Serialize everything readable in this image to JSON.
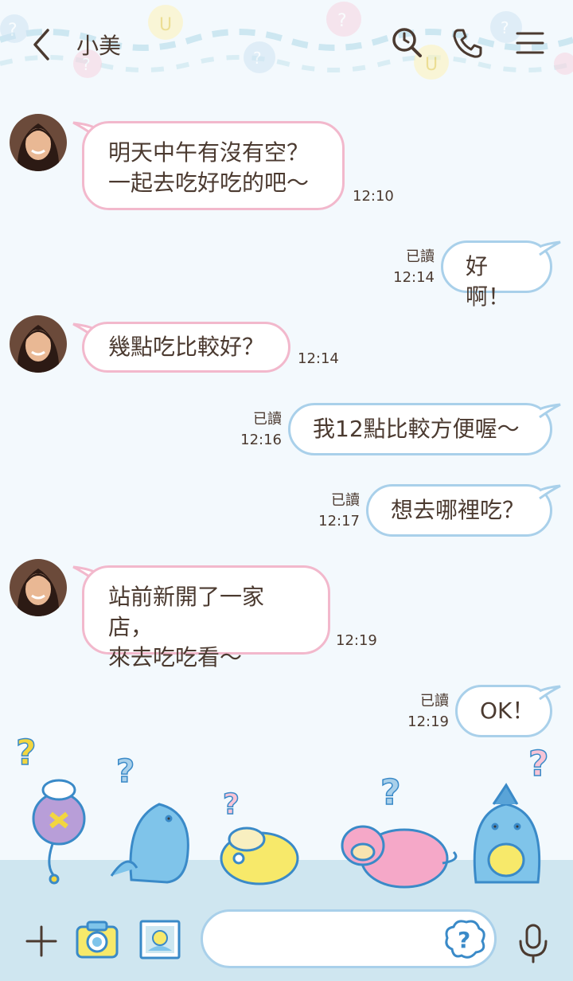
{
  "header": {
    "title": "小美",
    "back_icon": "chevron-left-icon",
    "icons": [
      "clock-search-icon",
      "phone-icon",
      "menu-icon"
    ]
  },
  "messages": [
    {
      "side": "in",
      "lines": [
        "明天中午有沒有空？",
        "一起去吃好吃的吧～"
      ],
      "time": "12:10"
    },
    {
      "side": "out",
      "text": "好啊！",
      "read": "已讀",
      "time": "12:14"
    },
    {
      "side": "in",
      "lines": [
        "幾點吃比較好？"
      ],
      "time": "12:14"
    },
    {
      "side": "out",
      "text": "我12點比較方便喔～",
      "read": "已讀",
      "time": "12:16"
    },
    {
      "side": "out",
      "text": "想去哪裡吃？",
      "read": "已讀",
      "time": "12:17"
    },
    {
      "side": "in",
      "lines": [
        "站前新開了一家店，",
        "來去吃吃看～"
      ],
      "time": "12:19"
    },
    {
      "side": "out",
      "text": "OK！",
      "read": "已讀",
      "time": "12:19"
    }
  ],
  "input": {
    "placeholder": "",
    "icons": [
      "plus-icon",
      "camera-icon",
      "image-icon",
      "question-sticker-icon",
      "microphone-icon"
    ]
  },
  "colors": {
    "background": "#f3f9fd",
    "incoming_border": "#f2b8cc",
    "outgoing_border": "#a9d0ea",
    "text": "#4b3a30",
    "floor": "#cfe6f0"
  }
}
